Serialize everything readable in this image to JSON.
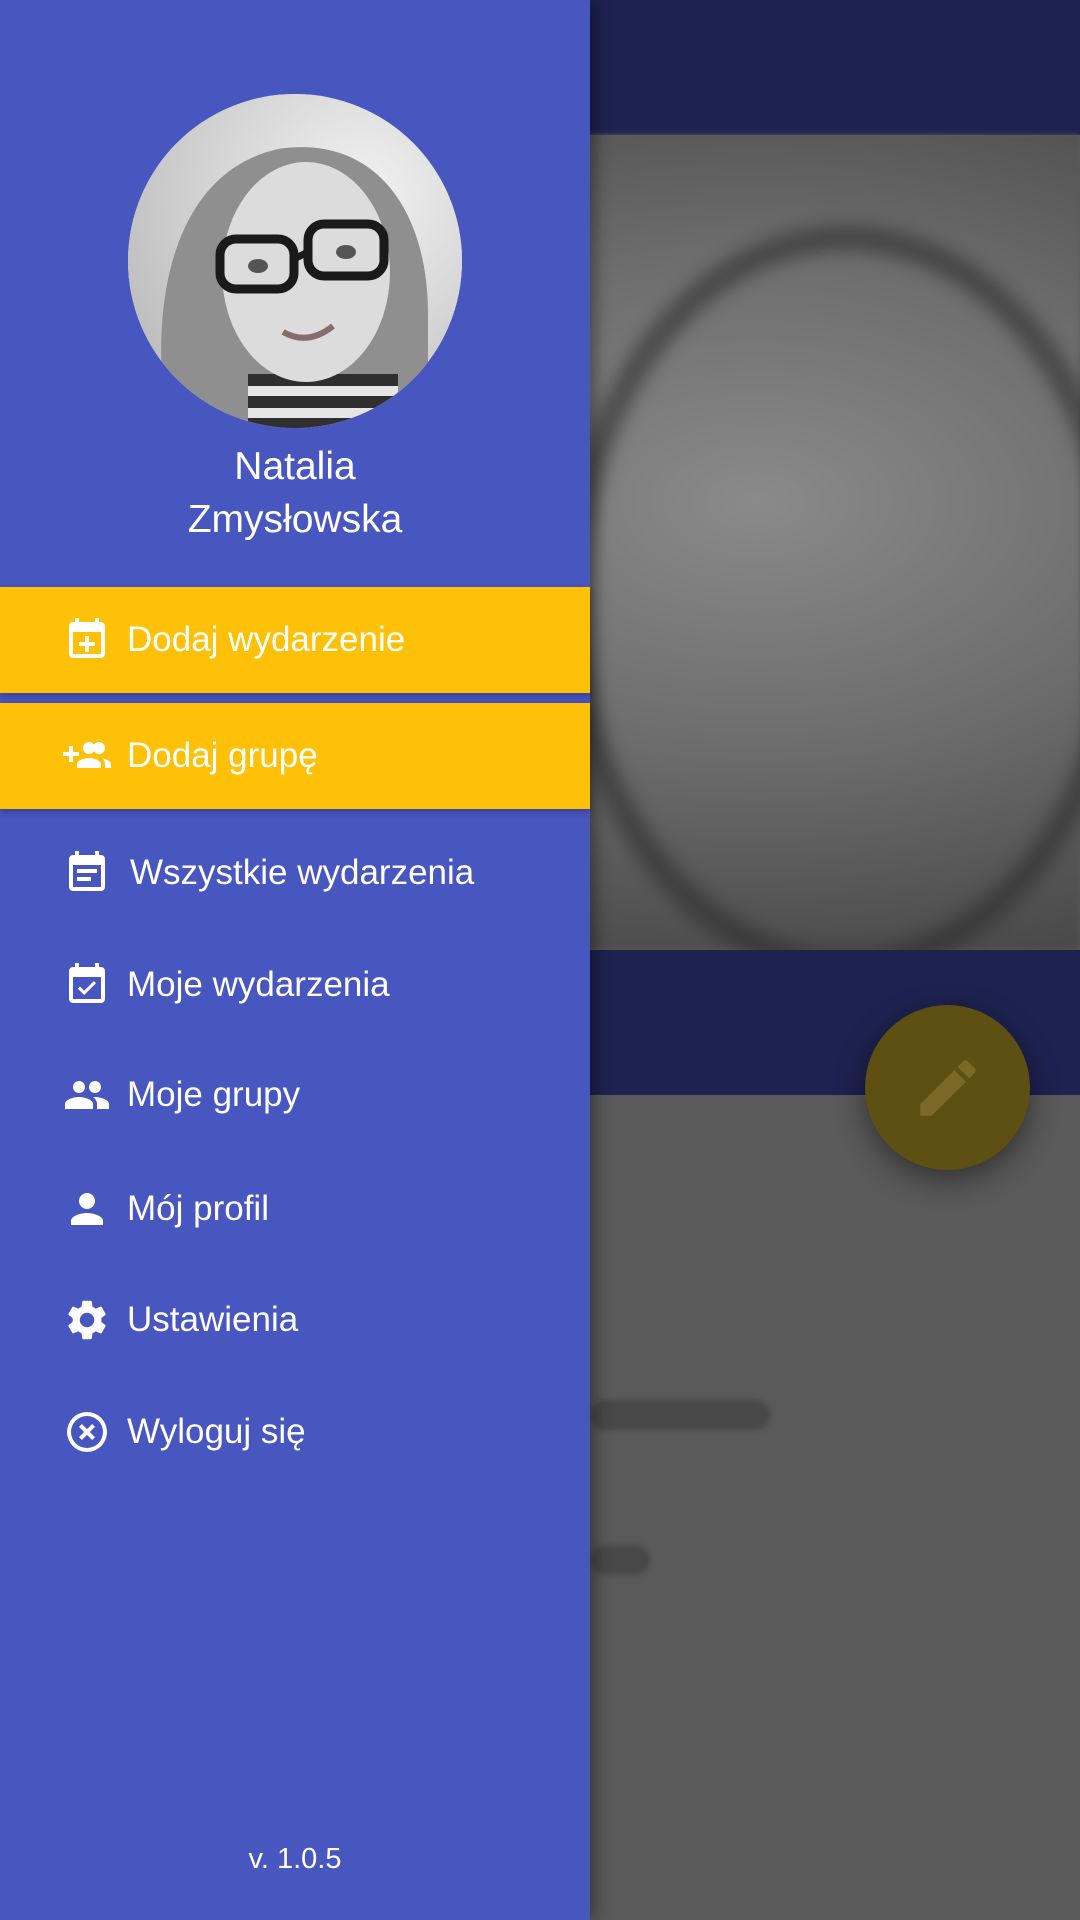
{
  "user": {
    "first_name": "Natalia",
    "last_name": "Zmysłowska"
  },
  "menu": {
    "items": [
      {
        "label": "Dodaj wydarzenie",
        "icon": "calendar-add-icon",
        "highlighted": true
      },
      {
        "label": "Dodaj grupę",
        "icon": "group-add-icon",
        "highlighted": true
      },
      {
        "label": "Wszystkie wydarzenia",
        "icon": "calendar-list-icon",
        "highlighted": false
      },
      {
        "label": "Moje wydarzenia",
        "icon": "calendar-check-icon",
        "highlighted": false
      },
      {
        "label": "Moje grupy",
        "icon": "people-icon",
        "highlighted": false
      },
      {
        "label": "Mój profil",
        "icon": "person-icon",
        "highlighted": false
      },
      {
        "label": "Ustawienia",
        "icon": "gear-icon",
        "highlighted": false
      },
      {
        "label": "Wyloguj się",
        "icon": "close-circle-icon",
        "highlighted": false
      }
    ]
  },
  "version": "v. 1.0.5",
  "colors": {
    "drawer": "#4856bf",
    "highlight": "#ffc107",
    "appbar": "#1d2250",
    "text": "#ffffff"
  },
  "background": {
    "fab_icon": "pencil-icon"
  }
}
